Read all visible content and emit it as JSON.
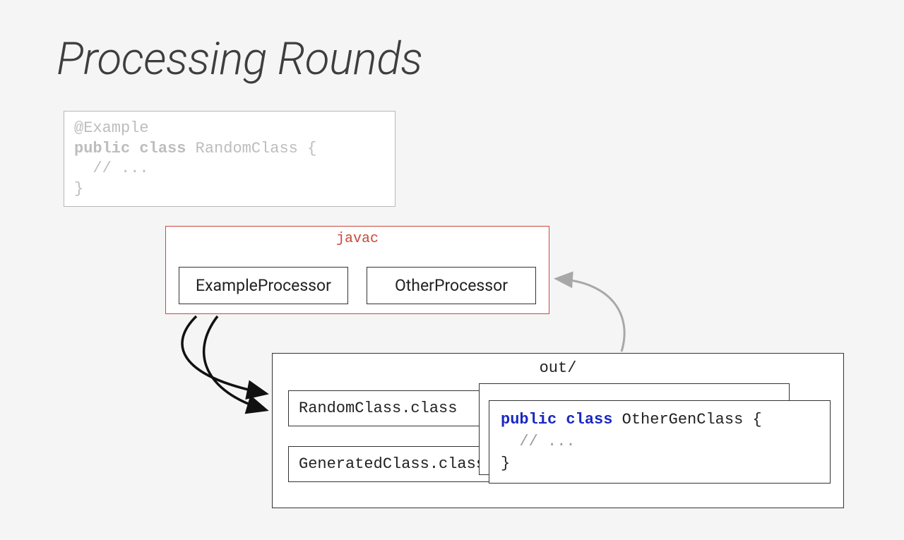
{
  "title": "Processing Rounds",
  "source": {
    "annotation": "@Example",
    "kw_public": "public",
    "kw_class": "class",
    "classname": "RandomClass {",
    "comment": "// ...",
    "close": "}"
  },
  "javac": {
    "label": "javac",
    "processors": [
      "ExampleProcessor",
      "OtherProcessor"
    ]
  },
  "out": {
    "label": "out/",
    "class_files": [
      "RandomClass.class",
      "GeneratedClass.class"
    ],
    "gen_code": {
      "kw_public": "public",
      "kw_class": "class",
      "classname": "OtherGenClass {",
      "comment": "// ...",
      "close": "}"
    }
  }
}
